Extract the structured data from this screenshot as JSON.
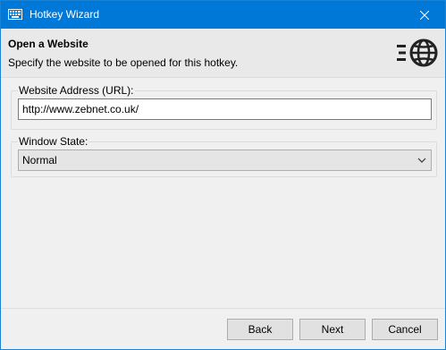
{
  "window": {
    "title": "Hotkey Wizard",
    "icon": "keyboard-icon",
    "accent_color": "#0078d7"
  },
  "header": {
    "title": "Open a Website",
    "subtitle": "Specify the website to be opened for this hotkey.",
    "icon": "globe-icon"
  },
  "url_group": {
    "label": "Website Address (URL):",
    "value": "http://www.zebnet.co.uk/"
  },
  "state_group": {
    "label": "Window State:",
    "selected": "Normal"
  },
  "buttons": {
    "back": "Back",
    "next": "Next",
    "cancel": "Cancel"
  }
}
